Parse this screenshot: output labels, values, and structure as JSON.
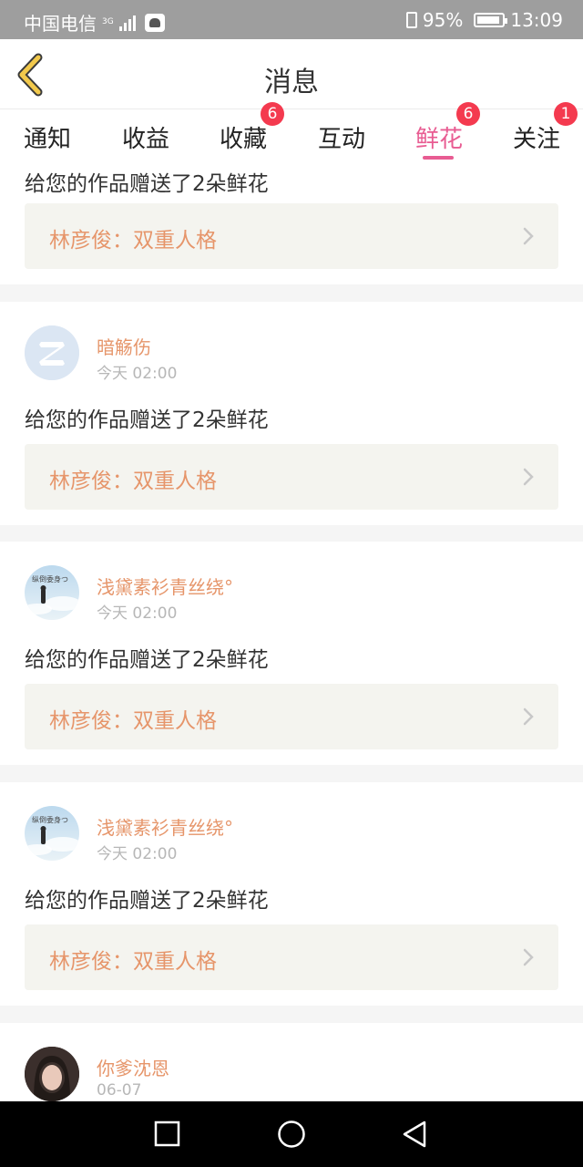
{
  "status_bar": {
    "carrier": "中国电信",
    "network": "3G",
    "battery": "95%",
    "time": "13:09"
  },
  "header": {
    "title": "消息"
  },
  "tabs": [
    {
      "label": "通知",
      "badge": ""
    },
    {
      "label": "收益",
      "badge": ""
    },
    {
      "label": "收藏",
      "badge": "6"
    },
    {
      "label": "互动",
      "badge": ""
    },
    {
      "label": "鲜花",
      "badge": "6",
      "active": true
    },
    {
      "label": "关注",
      "badge": "1"
    }
  ],
  "messages": [
    {
      "message": "给您的作品赠送了2朵鲜花",
      "work": "林彦俊：双重人格"
    },
    {
      "name": "暗觞伤",
      "time": "今天 02:00",
      "message": "给您的作品赠送了2朵鲜花",
      "work": "林彦俊：双重人格",
      "avatar": "qq-default-avatar-icon"
    },
    {
      "name": "浅黛素衫青丝绕°",
      "time": "今天 02:00",
      "message": "给您的作品赠送了2朵鲜花",
      "work": "林彦俊：双重人格",
      "avatar": "sky-girl-avatar"
    },
    {
      "name": "浅黛素衫青丝绕°",
      "time": "今天 02:00",
      "message": "给您的作品赠送了2朵鲜花",
      "work": "林彦俊：双重人格",
      "avatar": "sky-girl-avatar"
    },
    {
      "name": "你爹沈恩",
      "time": "06-07",
      "avatar": "portrait-avatar"
    }
  ],
  "colors": {
    "accent": "#e85c92",
    "name": "#e6956a",
    "badge": "#f43a4f",
    "back_arrow": "#f2c94c"
  }
}
